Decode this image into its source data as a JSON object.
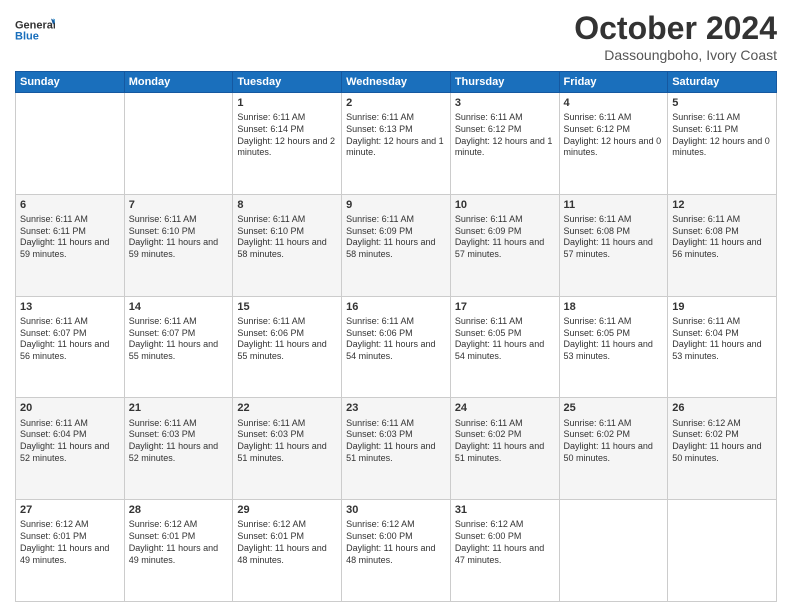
{
  "header": {
    "logo_general": "General",
    "logo_blue": "Blue",
    "month": "October 2024",
    "location": "Dassoungboho, Ivory Coast"
  },
  "weekdays": [
    "Sunday",
    "Monday",
    "Tuesday",
    "Wednesday",
    "Thursday",
    "Friday",
    "Saturday"
  ],
  "weeks": [
    [
      {
        "day": "",
        "sunrise": "",
        "sunset": "",
        "daylight": ""
      },
      {
        "day": "",
        "sunrise": "",
        "sunset": "",
        "daylight": ""
      },
      {
        "day": "1",
        "sunrise": "Sunrise: 6:11 AM",
        "sunset": "Sunset: 6:14 PM",
        "daylight": "Daylight: 12 hours and 2 minutes."
      },
      {
        "day": "2",
        "sunrise": "Sunrise: 6:11 AM",
        "sunset": "Sunset: 6:13 PM",
        "daylight": "Daylight: 12 hours and 1 minute."
      },
      {
        "day": "3",
        "sunrise": "Sunrise: 6:11 AM",
        "sunset": "Sunset: 6:12 PM",
        "daylight": "Daylight: 12 hours and 1 minute."
      },
      {
        "day": "4",
        "sunrise": "Sunrise: 6:11 AM",
        "sunset": "Sunset: 6:12 PM",
        "daylight": "Daylight: 12 hours and 0 minutes."
      },
      {
        "day": "5",
        "sunrise": "Sunrise: 6:11 AM",
        "sunset": "Sunset: 6:11 PM",
        "daylight": "Daylight: 12 hours and 0 minutes."
      }
    ],
    [
      {
        "day": "6",
        "sunrise": "Sunrise: 6:11 AM",
        "sunset": "Sunset: 6:11 PM",
        "daylight": "Daylight: 11 hours and 59 minutes."
      },
      {
        "day": "7",
        "sunrise": "Sunrise: 6:11 AM",
        "sunset": "Sunset: 6:10 PM",
        "daylight": "Daylight: 11 hours and 59 minutes."
      },
      {
        "day": "8",
        "sunrise": "Sunrise: 6:11 AM",
        "sunset": "Sunset: 6:10 PM",
        "daylight": "Daylight: 11 hours and 58 minutes."
      },
      {
        "day": "9",
        "sunrise": "Sunrise: 6:11 AM",
        "sunset": "Sunset: 6:09 PM",
        "daylight": "Daylight: 11 hours and 58 minutes."
      },
      {
        "day": "10",
        "sunrise": "Sunrise: 6:11 AM",
        "sunset": "Sunset: 6:09 PM",
        "daylight": "Daylight: 11 hours and 57 minutes."
      },
      {
        "day": "11",
        "sunrise": "Sunrise: 6:11 AM",
        "sunset": "Sunset: 6:08 PM",
        "daylight": "Daylight: 11 hours and 57 minutes."
      },
      {
        "day": "12",
        "sunrise": "Sunrise: 6:11 AM",
        "sunset": "Sunset: 6:08 PM",
        "daylight": "Daylight: 11 hours and 56 minutes."
      }
    ],
    [
      {
        "day": "13",
        "sunrise": "Sunrise: 6:11 AM",
        "sunset": "Sunset: 6:07 PM",
        "daylight": "Daylight: 11 hours and 56 minutes."
      },
      {
        "day": "14",
        "sunrise": "Sunrise: 6:11 AM",
        "sunset": "Sunset: 6:07 PM",
        "daylight": "Daylight: 11 hours and 55 minutes."
      },
      {
        "day": "15",
        "sunrise": "Sunrise: 6:11 AM",
        "sunset": "Sunset: 6:06 PM",
        "daylight": "Daylight: 11 hours and 55 minutes."
      },
      {
        "day": "16",
        "sunrise": "Sunrise: 6:11 AM",
        "sunset": "Sunset: 6:06 PM",
        "daylight": "Daylight: 11 hours and 54 minutes."
      },
      {
        "day": "17",
        "sunrise": "Sunrise: 6:11 AM",
        "sunset": "Sunset: 6:05 PM",
        "daylight": "Daylight: 11 hours and 54 minutes."
      },
      {
        "day": "18",
        "sunrise": "Sunrise: 6:11 AM",
        "sunset": "Sunset: 6:05 PM",
        "daylight": "Daylight: 11 hours and 53 minutes."
      },
      {
        "day": "19",
        "sunrise": "Sunrise: 6:11 AM",
        "sunset": "Sunset: 6:04 PM",
        "daylight": "Daylight: 11 hours and 53 minutes."
      }
    ],
    [
      {
        "day": "20",
        "sunrise": "Sunrise: 6:11 AM",
        "sunset": "Sunset: 6:04 PM",
        "daylight": "Daylight: 11 hours and 52 minutes."
      },
      {
        "day": "21",
        "sunrise": "Sunrise: 6:11 AM",
        "sunset": "Sunset: 6:03 PM",
        "daylight": "Daylight: 11 hours and 52 minutes."
      },
      {
        "day": "22",
        "sunrise": "Sunrise: 6:11 AM",
        "sunset": "Sunset: 6:03 PM",
        "daylight": "Daylight: 11 hours and 51 minutes."
      },
      {
        "day": "23",
        "sunrise": "Sunrise: 6:11 AM",
        "sunset": "Sunset: 6:03 PM",
        "daylight": "Daylight: 11 hours and 51 minutes."
      },
      {
        "day": "24",
        "sunrise": "Sunrise: 6:11 AM",
        "sunset": "Sunset: 6:02 PM",
        "daylight": "Daylight: 11 hours and 51 minutes."
      },
      {
        "day": "25",
        "sunrise": "Sunrise: 6:11 AM",
        "sunset": "Sunset: 6:02 PM",
        "daylight": "Daylight: 11 hours and 50 minutes."
      },
      {
        "day": "26",
        "sunrise": "Sunrise: 6:12 AM",
        "sunset": "Sunset: 6:02 PM",
        "daylight": "Daylight: 11 hours and 50 minutes."
      }
    ],
    [
      {
        "day": "27",
        "sunrise": "Sunrise: 6:12 AM",
        "sunset": "Sunset: 6:01 PM",
        "daylight": "Daylight: 11 hours and 49 minutes."
      },
      {
        "day": "28",
        "sunrise": "Sunrise: 6:12 AM",
        "sunset": "Sunset: 6:01 PM",
        "daylight": "Daylight: 11 hours and 49 minutes."
      },
      {
        "day": "29",
        "sunrise": "Sunrise: 6:12 AM",
        "sunset": "Sunset: 6:01 PM",
        "daylight": "Daylight: 11 hours and 48 minutes."
      },
      {
        "day": "30",
        "sunrise": "Sunrise: 6:12 AM",
        "sunset": "Sunset: 6:00 PM",
        "daylight": "Daylight: 11 hours and 48 minutes."
      },
      {
        "day": "31",
        "sunrise": "Sunrise: 6:12 AM",
        "sunset": "Sunset: 6:00 PM",
        "daylight": "Daylight: 11 hours and 47 minutes."
      },
      {
        "day": "",
        "sunrise": "",
        "sunset": "",
        "daylight": ""
      },
      {
        "day": "",
        "sunrise": "",
        "sunset": "",
        "daylight": ""
      }
    ]
  ]
}
